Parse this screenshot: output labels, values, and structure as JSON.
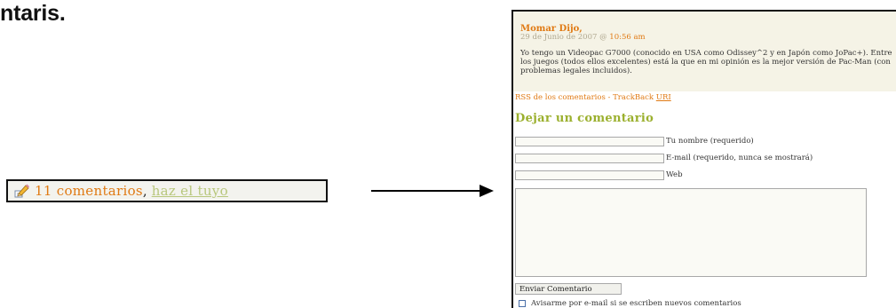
{
  "heading": {
    "text": "ntaris."
  },
  "widget": {
    "icon": "pencil-icon",
    "count_text": "11 comentarios",
    "comma": ",",
    "link_text": "haz el tuyo"
  },
  "arrow": {
    "icon": "right-arrow-icon"
  },
  "panel": {
    "comment": {
      "author": "Momar Dijo,",
      "date": "29 de Junio de 2007 @ ",
      "time": "10:56 am",
      "text": "Yo tengo un Videopac G7000 (conocido en USA como Odissey^2 y en Japón como JoPac+). Entre los juegos (todos ellos excelentes) está la que en mi opinión es la mejor versión de Pac-Man (con problemas legales incluidos)."
    },
    "links": {
      "rss": "RSS de los comentarios",
      "separator": " - ",
      "trackback": "TrackBack ",
      "uri": "URI"
    },
    "form": {
      "title": "Dejar un comentario",
      "name_label": "Tu nombre (requerido)",
      "email_label": "E-mail (requerido, nunca se mostrará)",
      "web_label": "Web",
      "submit_label": "Enviar Comentario",
      "notify_label": "Avisarme por e-mail si se escriben nuevos comentarios"
    },
    "colors": {
      "accent_orange": "#e07a14",
      "title_green": "#9bb02e",
      "comment_bg": "#f5f3e6"
    }
  }
}
